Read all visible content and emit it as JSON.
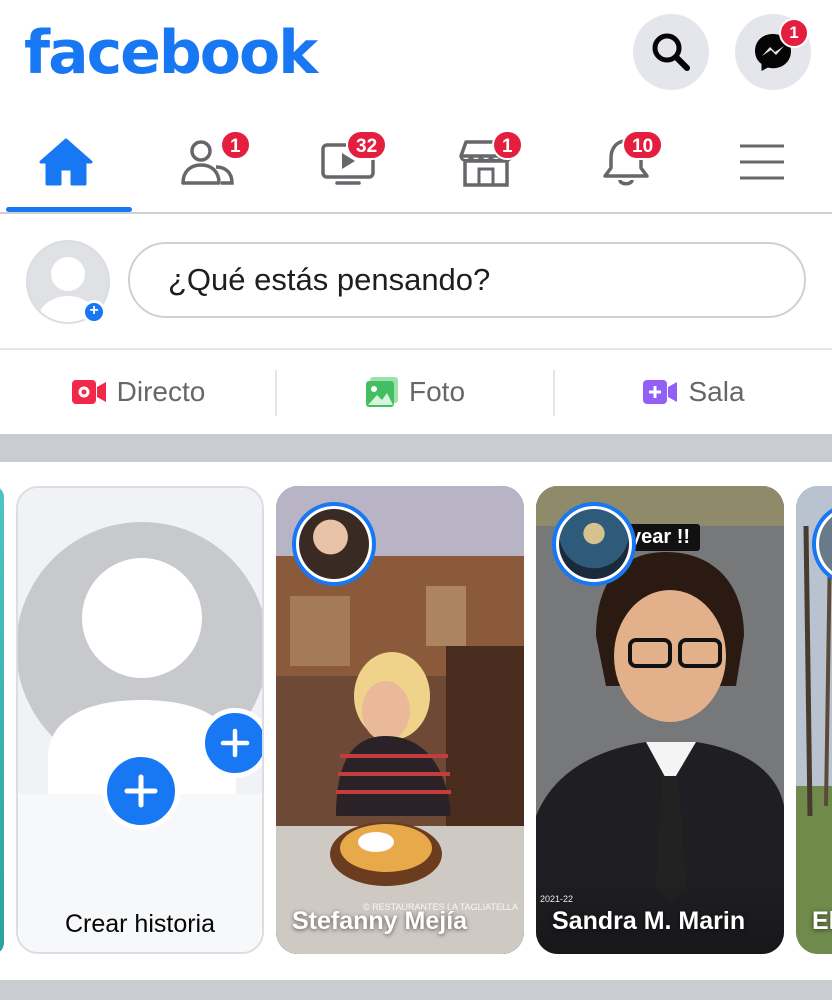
{
  "header": {
    "logo": "facebook",
    "messenger_badge": "1"
  },
  "nav": {
    "friends_badge": "1",
    "watch_badge": "32",
    "marketplace_badge": "1",
    "notifications_badge": "10"
  },
  "composer": {
    "placeholder": "¿Qué estás pensando?"
  },
  "actions": [
    {
      "label": "Directo",
      "icon": "live-video-icon",
      "color": "#f02849"
    },
    {
      "label": "Foto",
      "icon": "photo-icon",
      "color": "#45bd62"
    },
    {
      "label": "Sala",
      "icon": "room-icon",
      "color": "#9360f7"
    }
  ],
  "stories": {
    "create_label": "Crear historia",
    "items": [
      {
        "name": "Stefanny Mejía",
        "overlay_text": "© RESTAURANTES LA TAGLIATELLA"
      },
      {
        "name": "Sandra M. Marin",
        "overlay_text": "year !!",
        "year_text": "2021-22"
      },
      {
        "name": "El"
      }
    ]
  },
  "colors": {
    "brand": "#1877f2",
    "badge": "#e41e3f",
    "icon_gray": "#65676b"
  }
}
